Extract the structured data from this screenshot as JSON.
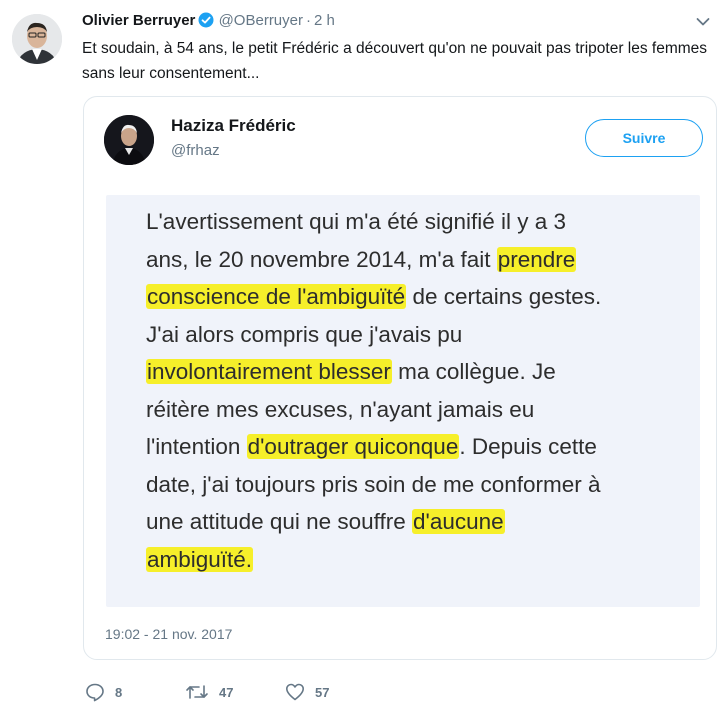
{
  "tweet": {
    "author_name": "Olivier Berruyer",
    "handle": "@OBerruyer",
    "separator": "·",
    "time": "2 h",
    "text": "Et soudain, à 54 ans, le petit Frédéric a découvert qu'on ne pouvait pas tripoter les femmes sans leur consentement...",
    "verified_icon": "verified-badge-icon",
    "menu_icon": "chevron-down-icon"
  },
  "quoted": {
    "author_name": "Haziza Frédéric",
    "handle": "@frhaz",
    "follow_label": "Suivre",
    "timestamp": "19:02 - 21 nov. 2017",
    "statement": {
      "line1": "L'avertissement qui m'a été signifié il y a 3",
      "line2_a": "ans, le 20 novembre 2014, m'a fait ",
      "line2_hl": "prendre",
      "line3_hl": "conscience de l'ambiguïté",
      "line3_b": " de certains gestes.",
      "line4": "J'ai alors compris que j'avais pu",
      "line5_hl": "involontairement blesser",
      "line5_b": " ma collègue. Je",
      "line6": "réitère mes excuses, n'ayant jamais eu",
      "line7_a": "l'intention ",
      "line7_hl": "d'outrager quiconque",
      "line7_b": ". Depuis cette",
      "line8": "date, j'ai toujours pris soin  de me conformer à",
      "line9_a": "une attitude qui ne souffre ",
      "line9_hl": "d'aucune",
      "line10_hl": "ambiguïté."
    }
  },
  "actions": {
    "replies": "8",
    "retweets": "47",
    "likes": "57"
  },
  "colors": {
    "accent": "#1da1f2",
    "highlight": "#f6ef2a",
    "muted": "#657786"
  }
}
